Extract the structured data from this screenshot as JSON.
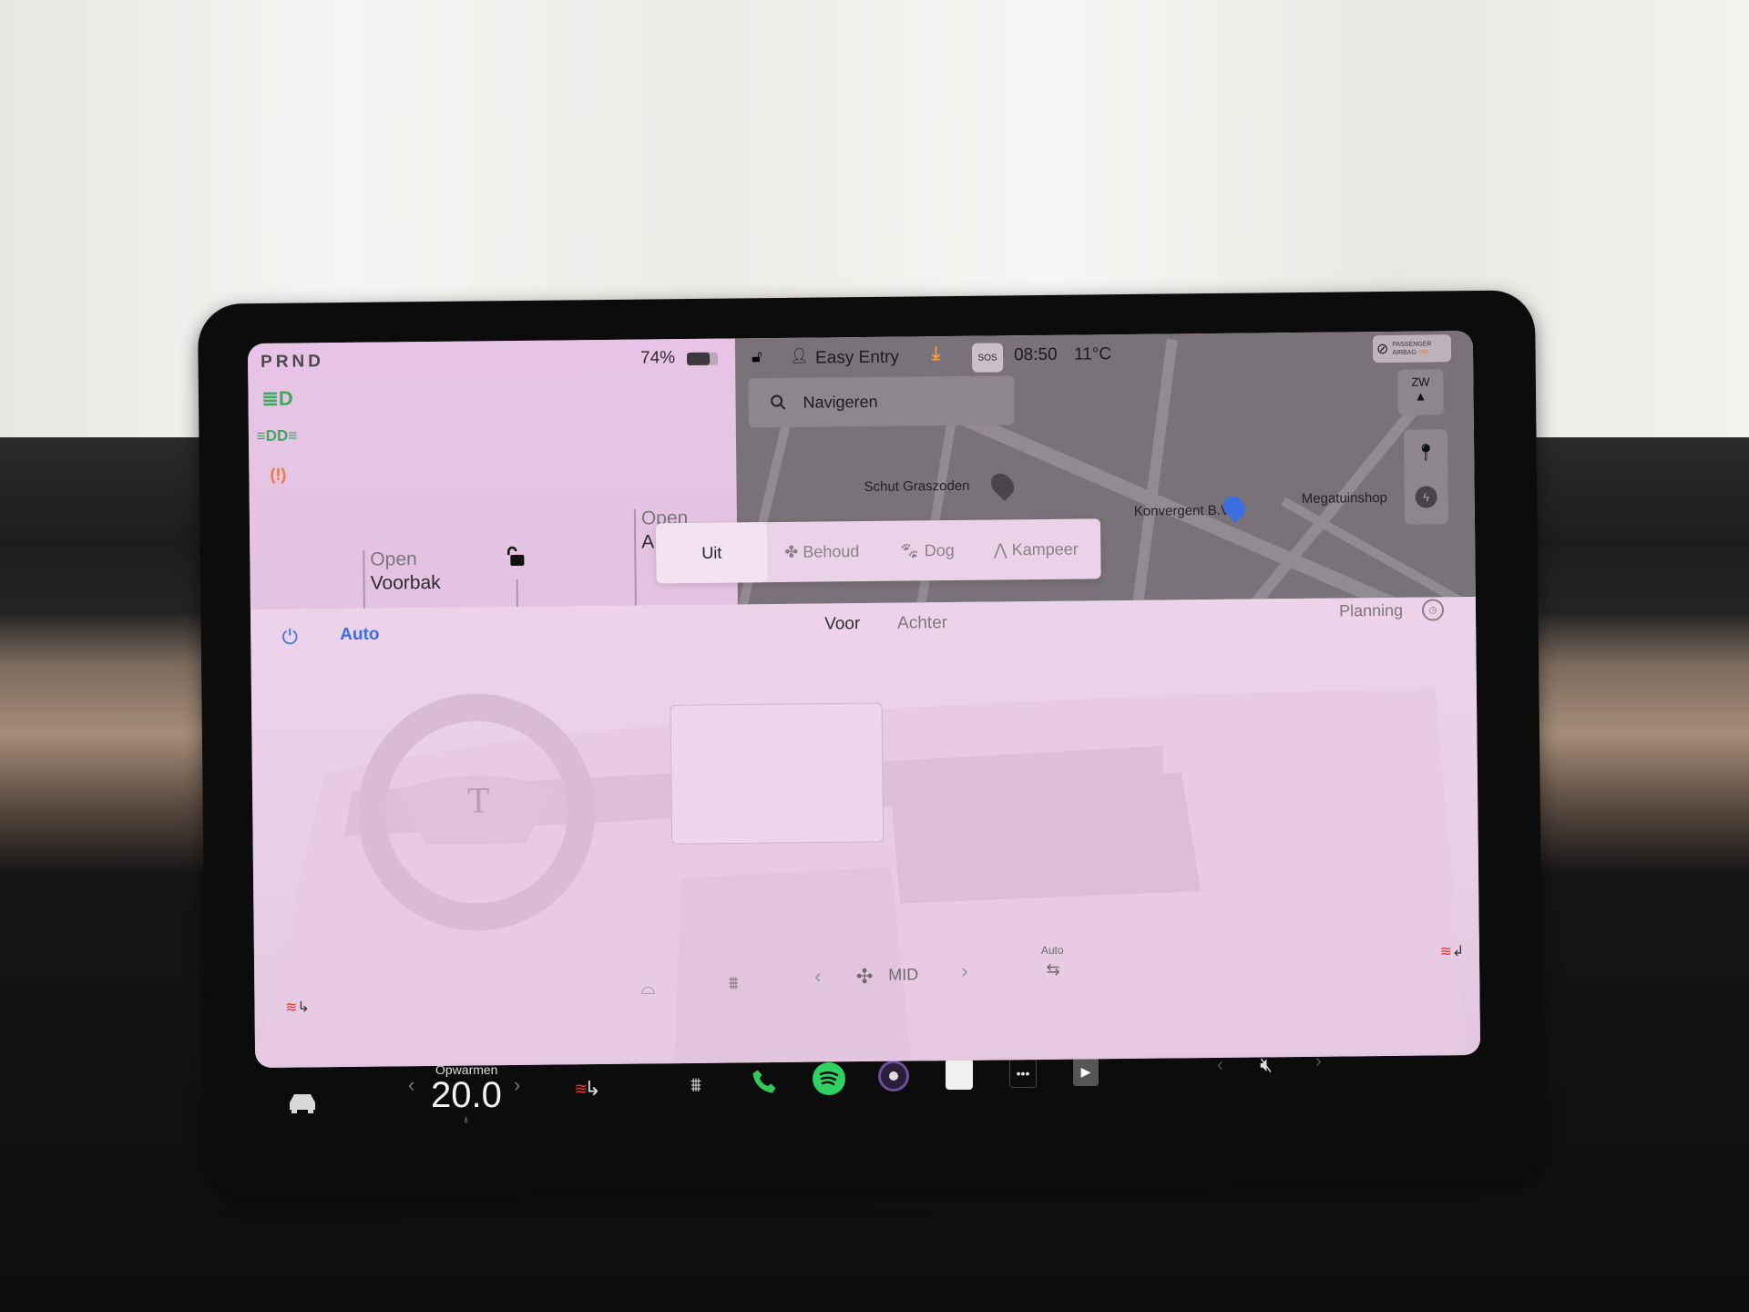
{
  "status": {
    "gear": "PRND",
    "battery_percent": "74%",
    "battery_level": 0.74,
    "profile": "Easy Entry",
    "time": "08:50",
    "temperature": "11°C",
    "sos_label": "SOS",
    "airbag": {
      "line1": "PASSENGER",
      "line2": "AIRBAG",
      "state": "ON"
    }
  },
  "indicators": [
    "headlight-icon",
    "parking-lights-icon",
    "tire-pressure-warning-icon"
  ],
  "car_panel": {
    "frunk_action": "Open",
    "frunk_label": "Voorbak",
    "trunk_action": "Open",
    "trunk_label": "A"
  },
  "climate_keeper": {
    "options": [
      "Uit",
      "Behoud",
      "Dog",
      "Kampeer"
    ],
    "selected": "Uit"
  },
  "map": {
    "search_placeholder": "Navigeren",
    "compass": "ZW",
    "places": [
      "Schut Graszoden",
      "Konvergent B.V",
      "Megatuinshop"
    ]
  },
  "climate": {
    "mode": "Auto",
    "tabs": [
      "Voor",
      "Achter"
    ],
    "active_tab": "Voor",
    "planning": "Planning",
    "fan_speed": "MID",
    "recirc_label": "Auto"
  },
  "bottom_bar": {
    "temp_status": "Opwarmen",
    "temperature": "20.0",
    "apps": [
      "phone-icon",
      "spotify-icon",
      "camera-icon",
      "notes-icon",
      "more-icon",
      "theater-icon"
    ],
    "volume_state": "muted"
  },
  "colors": {
    "accent_blue": "#3b6fe0",
    "indicator_green": "#3fa860",
    "warning_orange": "#e8793f",
    "spotify_green": "#2fd160",
    "phone_green": "#34c759",
    "download_orange": "#f29a3a"
  }
}
